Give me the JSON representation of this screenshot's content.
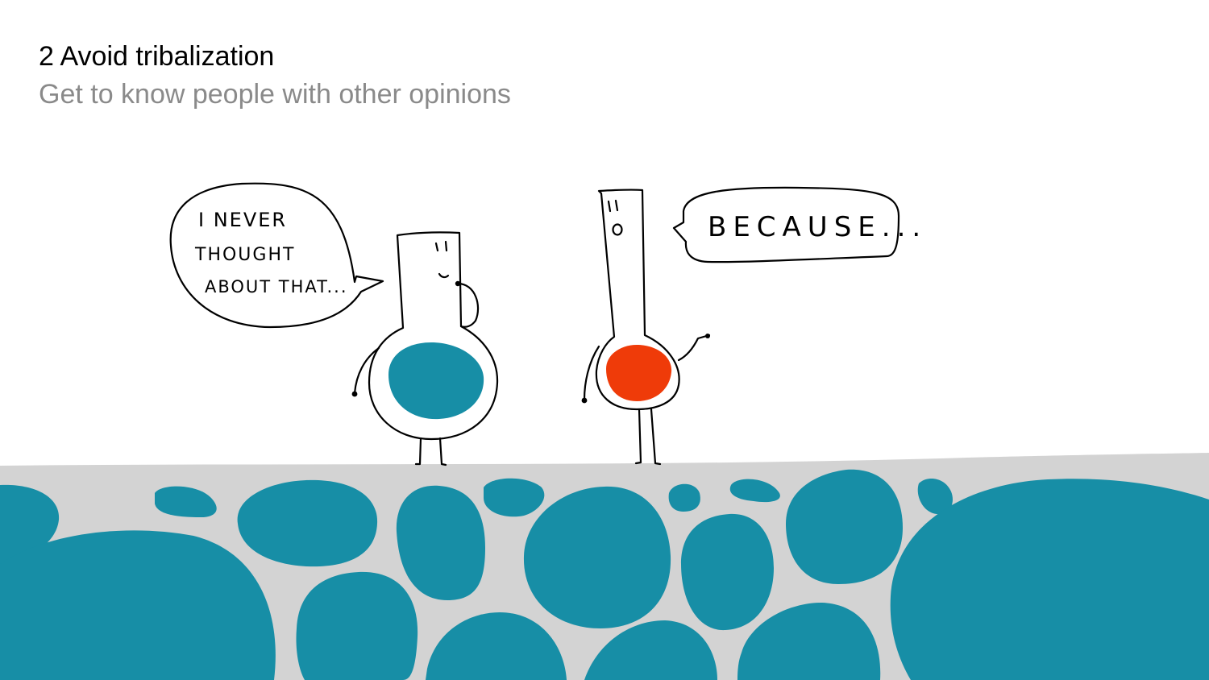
{
  "slide": {
    "title": "2 Avoid tribalization",
    "subtitle": "Get to know people with other opinions"
  },
  "illustration": {
    "left_bubble_lines": [
      "I NEVER",
      "THOUGHT",
      "ABOUT THAT..."
    ],
    "right_bubble_text": "BECAUSE...",
    "colors": {
      "ground": "#d3d3d3",
      "blue": "#178ea6",
      "red": "#ef3b09",
      "ink": "#000000",
      "subtitle": "#8a8a8a"
    }
  }
}
